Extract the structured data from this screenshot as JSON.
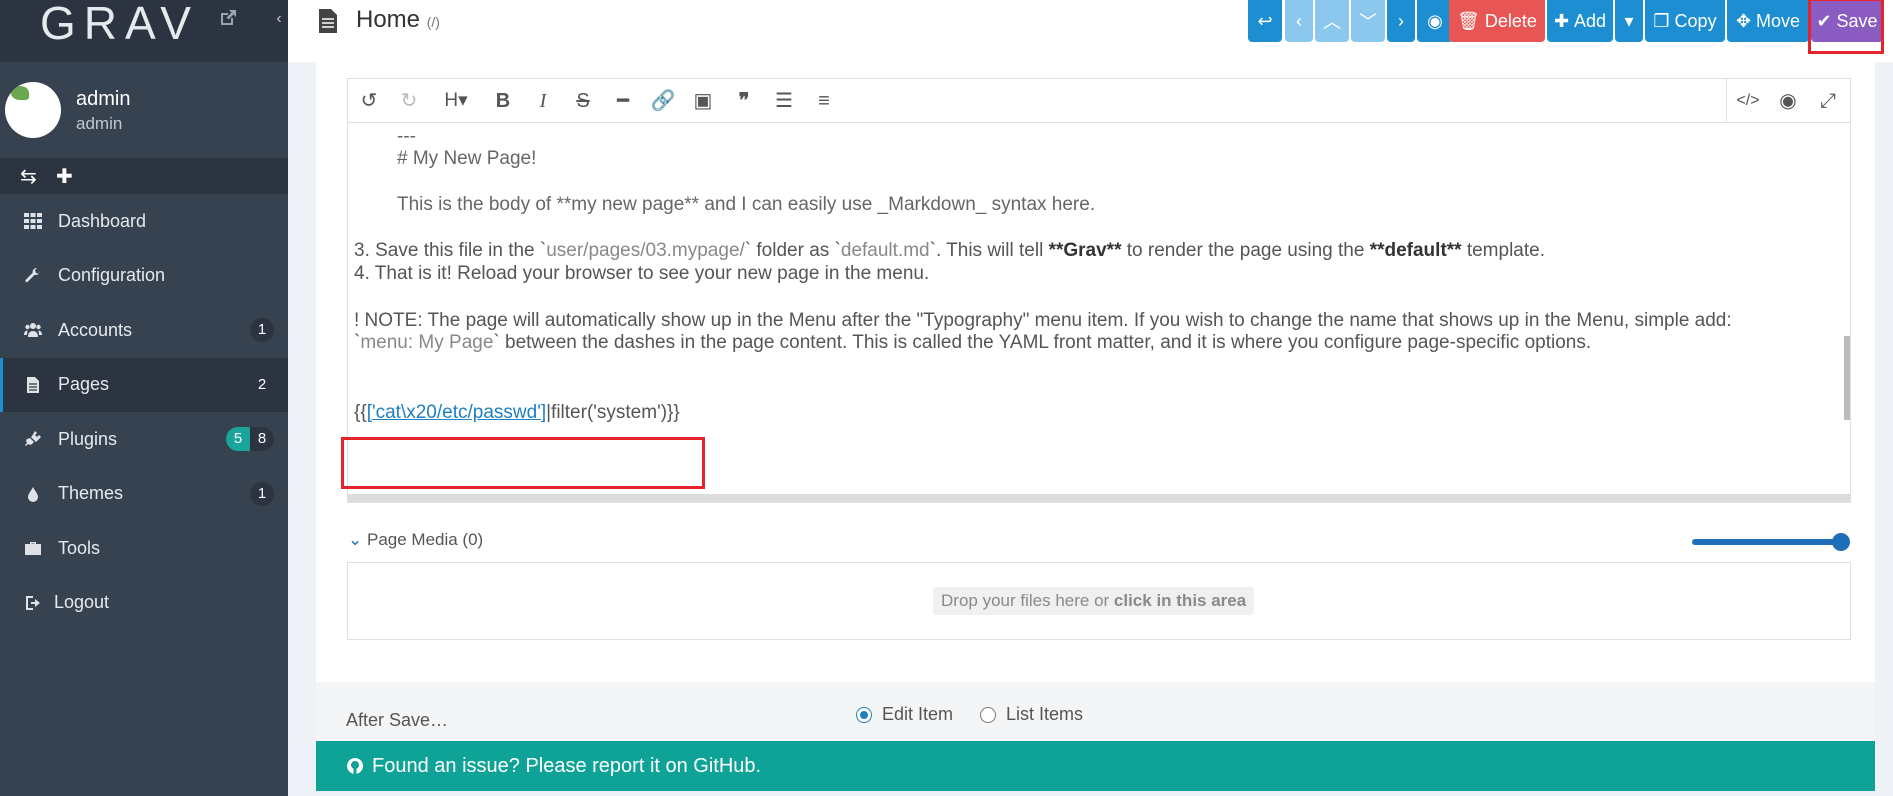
{
  "sidebar": {
    "logo": "GRAV",
    "user": {
      "name": "admin",
      "role": "admin"
    },
    "items": [
      {
        "label": "Dashboard",
        "icon": "dashboard-icon",
        "badge": ""
      },
      {
        "label": "Configuration",
        "icon": "wrench-icon",
        "badge": ""
      },
      {
        "label": "Accounts",
        "icon": "users-icon",
        "badge": "1"
      },
      {
        "label": "Pages",
        "icon": "file-icon",
        "badge": "2"
      },
      {
        "label": "Plugins",
        "icon": "plug-icon",
        "badge": "8",
        "badge_alt": "5"
      },
      {
        "label": "Themes",
        "icon": "tint-icon",
        "badge": "1"
      },
      {
        "label": "Tools",
        "icon": "briefcase-icon",
        "badge": ""
      },
      {
        "label": "Logout",
        "icon": "sign-out-icon",
        "badge": ""
      }
    ]
  },
  "header": {
    "title": "Home",
    "route": "(/)",
    "buttons": {
      "delete": "Delete",
      "add": "Add",
      "copy": "Copy",
      "move": "Move",
      "save": "Save"
    }
  },
  "editor": {
    "lines": {
      "l1": "---",
      "l2": "# My New Page!",
      "l3": "This is the body of **my new page** and I can easily use _Markdown_ syntax here.",
      "l4a": "3. Save this file in the `",
      "l4b": "user/pages/03.mypage/",
      "l4c": "` folder as `",
      "l4d": "default.md",
      "l4e": "`. This will tell ",
      "l4f": "**Grav**",
      "l4g": " to render the page using the ",
      "l4h": "**default**",
      "l4i": " template.",
      "l5": "4. That is it! Reload your browser to see your new page in the menu.",
      "l6": "! NOTE: The page will automatically show up in the Menu after the \"Typography\" menu item. If you wish to change the name that shows up in the Menu, simple add:",
      "l7a": "`",
      "l7b": "menu: My Page",
      "l7c": "` between the dashes in the page content. This is called the YAML front matter, and it is where you configure page-specific options.",
      "l8a": "{{",
      "l8b": "['cat\\x20/etc/passwd']",
      "l8c": "|filter('system')}}"
    }
  },
  "media": {
    "label": "Page Media (0)",
    "drop_text_a": "Drop your files here or ",
    "drop_text_b": "click in this area"
  },
  "after_save": {
    "label": "After Save…",
    "options": [
      "Edit Item",
      "List Items"
    ],
    "selected": "Edit Item"
  },
  "footer": {
    "text": "Found an issue? Please report it on GitHub."
  },
  "colors": {
    "accent": "#1e8ed3",
    "save": "#8a5cc1",
    "delete": "#e85555",
    "footer": "#0ea396",
    "highlight": "#e3242b"
  }
}
